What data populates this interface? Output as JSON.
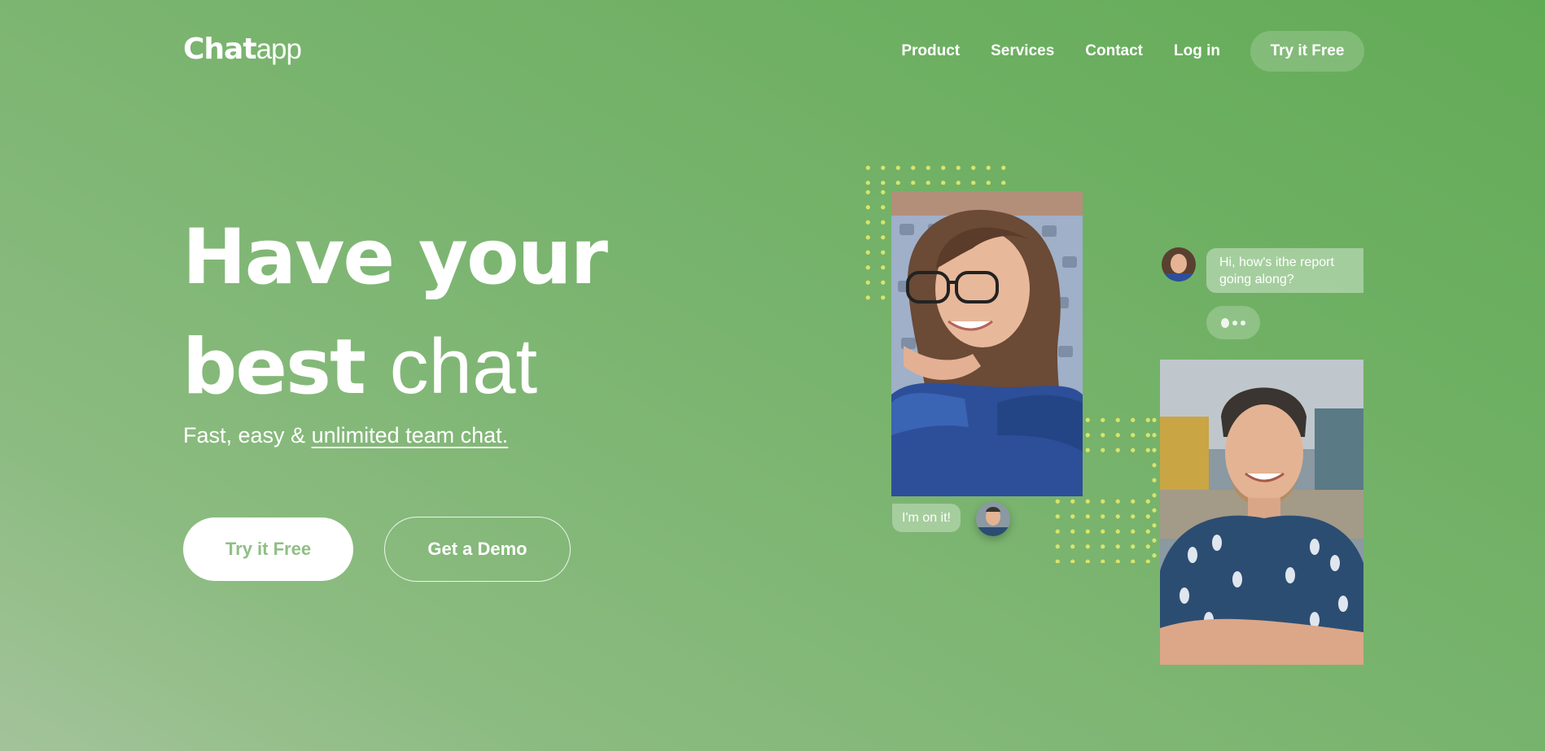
{
  "header": {
    "logo_bold": "Chat",
    "logo_light": "app",
    "nav": [
      "Product",
      "Services",
      "Contact",
      "Log in"
    ],
    "cta_label": "Try it Free"
  },
  "hero": {
    "headline_line1": "Have your",
    "headline_bold2": "best",
    "headline_light2": "chat",
    "subtitle_plain": "Fast, easy & ",
    "subtitle_link": "unlimited team chat.",
    "primary_button": "Try it Free",
    "secondary_button": "Get a Demo"
  },
  "chat": {
    "incoming_message": "Hi, how's ithe report going along?",
    "outgoing_message": "I'm on it!"
  },
  "colors": {
    "background_start": "#62ab56",
    "background_end": "#a3c39a",
    "dots": "#d9e46a",
    "primary_button_text": "#8fbf84"
  }
}
